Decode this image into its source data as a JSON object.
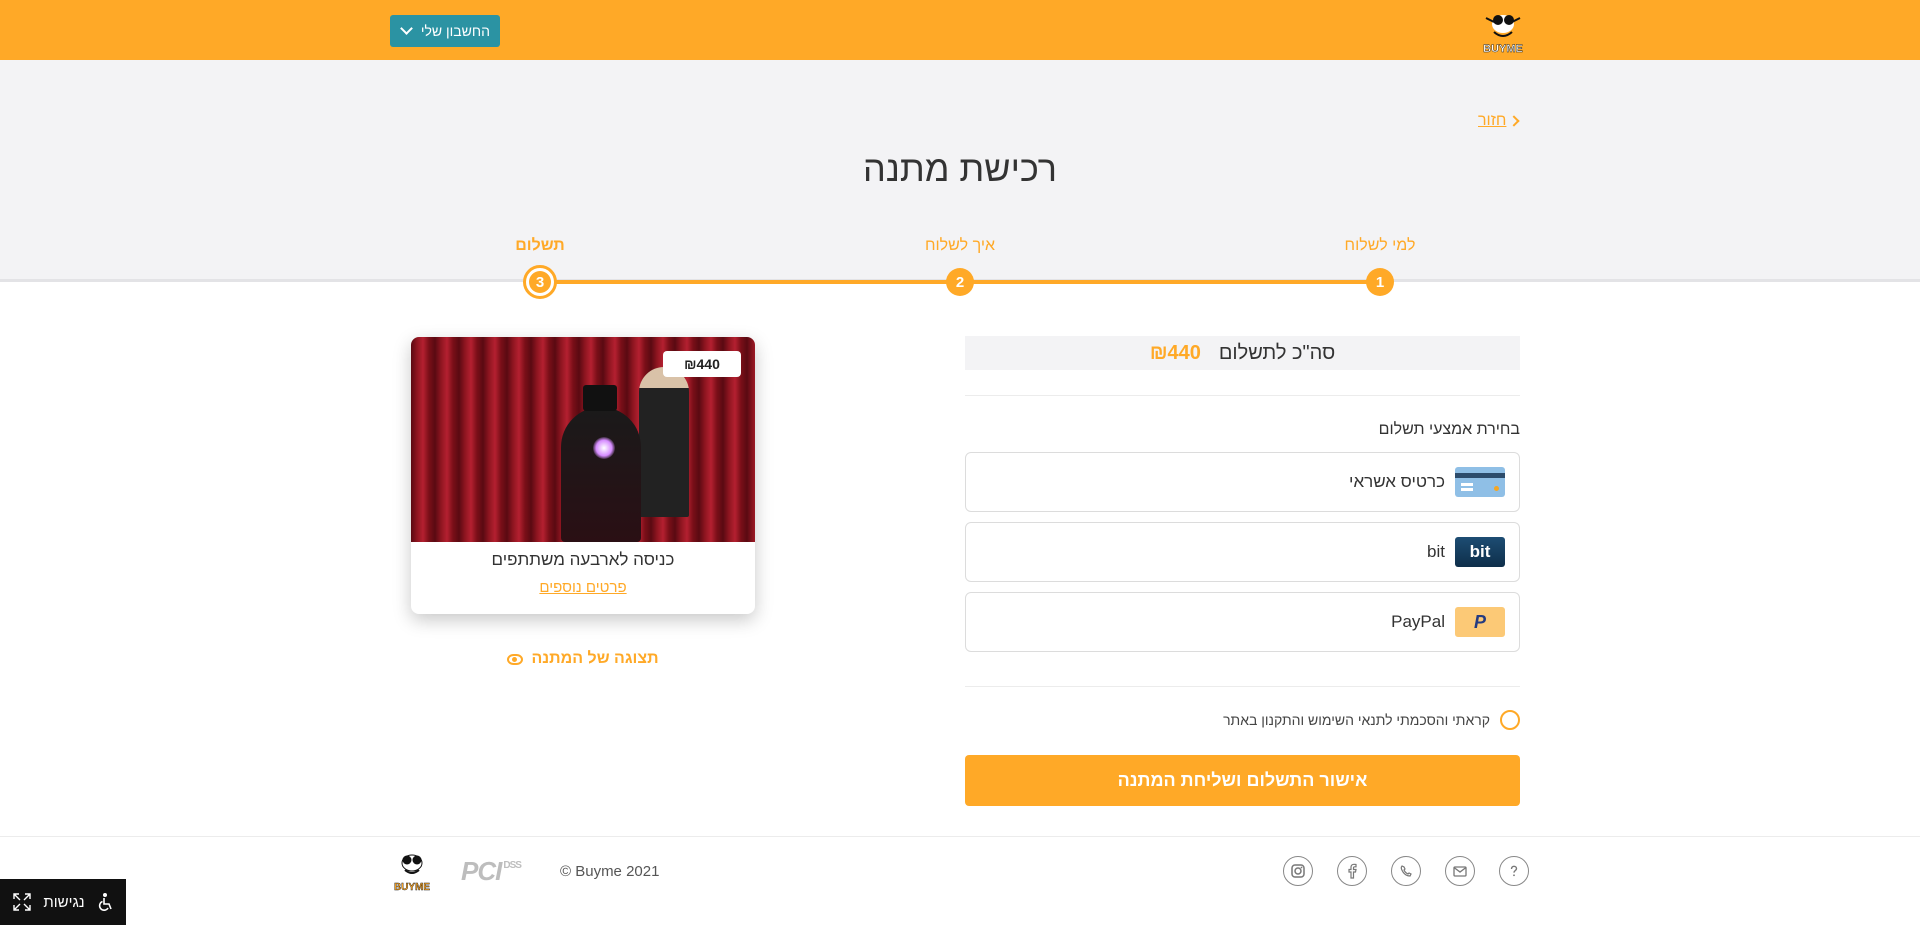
{
  "header": {
    "account_label": "החשבון שלי",
    "logo_text": "BUYME"
  },
  "back_label": "חזור",
  "page_title": "רכישת מתנה",
  "steps": [
    {
      "number": "1",
      "label": "למי לשלוח"
    },
    {
      "number": "2",
      "label": "איך לשלוח"
    },
    {
      "number": "3",
      "label": "תשלום"
    }
  ],
  "payment": {
    "total_label": "סה\"כ לתשלום",
    "total_amount": "₪440",
    "method_title": "בחירת אמצעי תשלום",
    "methods": [
      {
        "label": "כרטיס אשראי",
        "icon": "credit-card-icon"
      },
      {
        "label": "bit",
        "icon": "bit-icon",
        "icon_text": "bit"
      },
      {
        "label": "PayPal",
        "icon": "paypal-icon",
        "icon_text": "P"
      }
    ],
    "terms_label": "קראתי והסכמתי לתנאי השימוש והתקנון באתר",
    "submit_label": "אישור התשלום ושליחת המתנה"
  },
  "gift": {
    "price": "₪440",
    "title": "כניסה לארבעה משתתפים",
    "more_label": "פרטים נוספים",
    "preview_label": "תצוגה של המתנה"
  },
  "footer": {
    "copyright": "© Buyme 2021",
    "pci_text": "PCI",
    "pci_sub": "DSS",
    "logo_text": "BUYME"
  },
  "accessibility_label": "נגישות",
  "colors": {
    "brand": "#ffa927",
    "account_button": "#2b93a3"
  }
}
